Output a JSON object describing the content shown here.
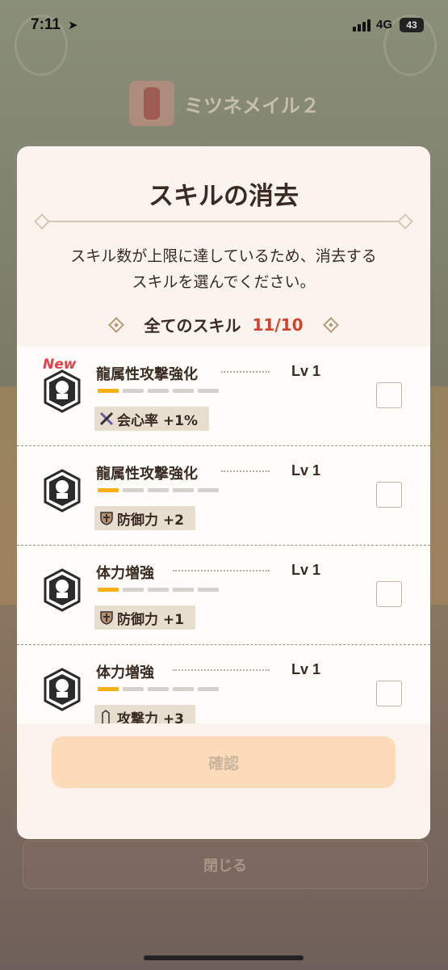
{
  "status_bar": {
    "time": "7:11",
    "network": "4G",
    "battery": "43"
  },
  "background": {
    "equipment_name": "ミツネメイル２",
    "close_button": "閉じる"
  },
  "modal": {
    "title": "スキルの消去",
    "message_line1": "スキル数が上限に達しているため、消去する",
    "message_line2": "スキルを選んでください。",
    "header_label": "全てのスキル",
    "header_count": "11/10",
    "confirm_label": "確認",
    "skills": [
      {
        "name": "龍属性攻撃強化",
        "level": "Lv 1",
        "is_new": true,
        "new_badge": "New",
        "stat": "会心率 +1%",
        "stat_icon": "crossed-blades-icon",
        "level_bar": 1
      },
      {
        "name": "龍属性攻撃強化",
        "level": "Lv 1",
        "is_new": false,
        "stat": "防御力 +2",
        "stat_icon": "shield-cross-icon",
        "level_bar": 1
      },
      {
        "name": "体力増強",
        "level": "Lv 1",
        "is_new": false,
        "stat": "防御力 +1",
        "stat_icon": "shield-cross-icon",
        "level_bar": 1
      },
      {
        "name": "体力増強",
        "level": "Lv 1",
        "is_new": false,
        "stat": "攻撃力 +3",
        "stat_icon": "sword-icon",
        "level_bar": 1
      }
    ]
  },
  "colors": {
    "accent_count": "#d0432d",
    "level_fill": "#f4b014",
    "confirm_disabled_bg": "#fcdcb8"
  }
}
